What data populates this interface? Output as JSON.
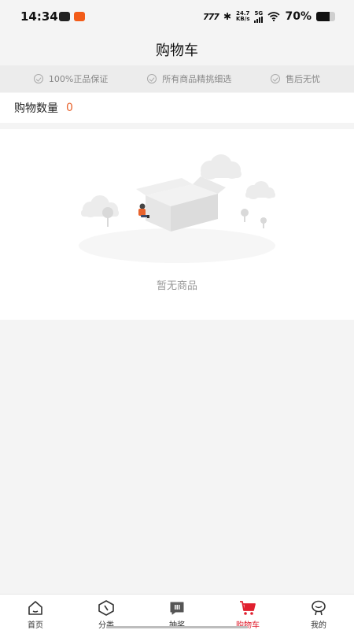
{
  "status_bar": {
    "time": "14:34",
    "nfc": "777",
    "bluetooth": "✱",
    "net_speed_value": "24.7",
    "net_speed_unit": "KB/s",
    "signal_label": "5G",
    "battery_text": "70%",
    "battery_level": 0.7
  },
  "header": {
    "title": "购物车"
  },
  "guarantees": [
    {
      "label": "100%正品保证",
      "icon": "check-circle-icon"
    },
    {
      "label": "所有商品精挑细选",
      "icon": "check-circle-icon"
    },
    {
      "label": "售后无忧",
      "icon": "check-circle-icon"
    }
  ],
  "cart_count": {
    "label": "购物数量",
    "value": "0"
  },
  "empty_state": {
    "text": "暂无商品",
    "illustration": "empty-box-illustration"
  },
  "tabbar": {
    "items": [
      {
        "label": "首页",
        "icon": "home-icon"
      },
      {
        "label": "分类",
        "icon": "compass-icon"
      },
      {
        "label": "抽奖",
        "icon": "lottery-icon"
      },
      {
        "label": "购物车",
        "icon": "cart-icon",
        "active": true
      },
      {
        "label": "我的",
        "icon": "profile-icon"
      }
    ]
  },
  "colors": {
    "accent": "#e0202f",
    "count": "#e8632d",
    "background": "#f4f4f4"
  }
}
